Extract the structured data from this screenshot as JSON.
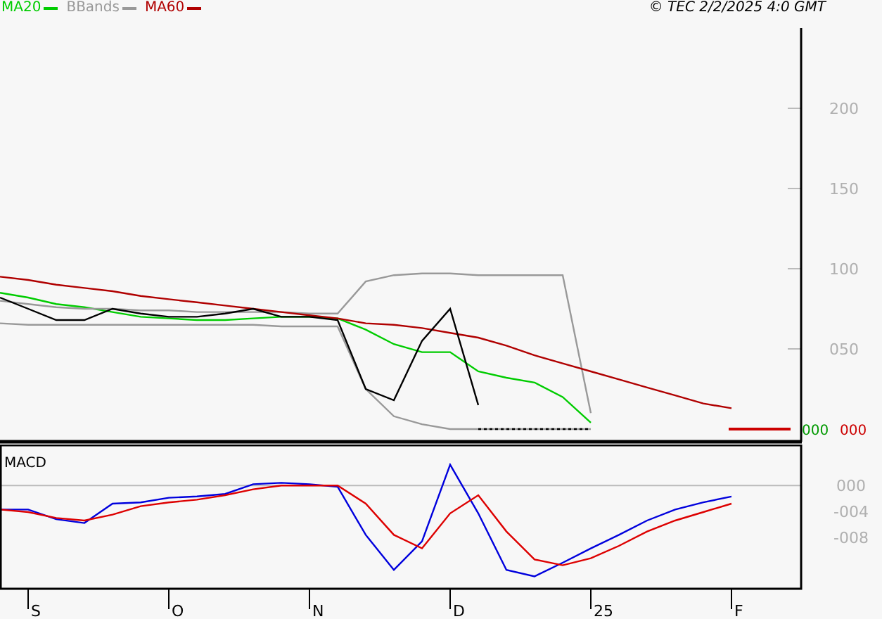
{
  "copyright": "© TEC 2/2/2025 4:0 GMT",
  "price_chart": {
    "chart_data": {
      "type": "line",
      "categories": [
        null,
        null,
        null,
        null,
        null,
        null,
        null,
        null,
        null,
        null,
        null,
        null,
        null,
        null,
        null,
        null,
        null,
        null,
        null,
        null,
        null,
        null,
        null,
        null,
        null,
        null,
        null,
        null,
        null
      ],
      "ylim": [
        -7.9,
        250
      ],
      "yticks": [
        {
          "value": 50,
          "label": "050"
        },
        {
          "value": 100,
          "label": "100"
        },
        {
          "value": 150,
          "label": "150"
        },
        {
          "value": 200,
          "label": "200"
        }
      ],
      "series": [
        {
          "name": "MA20",
          "color": "#00cc00",
          "values": [
            85,
            82,
            78,
            76,
            73,
            70,
            69,
            68,
            68,
            69,
            70,
            70,
            69,
            62,
            53,
            48,
            48,
            36,
            32,
            29,
            20,
            4,
            null,
            null,
            null,
            null,
            null,
            null,
            null
          ]
        },
        {
          "name": "BBands",
          "color": "#999999",
          "values": [
            80,
            78,
            76,
            75,
            75,
            74,
            74,
            73,
            73,
            73,
            73,
            72,
            72,
            92,
            96,
            97,
            97,
            96,
            96,
            96,
            96,
            10,
            null,
            null,
            null,
            null,
            null,
            null,
            null
          ]
        },
        {
          "name": "MA60",
          "color": "#b00000",
          "values": [
            95,
            93,
            90,
            88,
            86,
            83,
            81,
            79,
            77,
            75,
            73,
            71,
            69,
            66,
            65,
            63,
            60,
            57,
            52,
            46,
            41,
            36,
            31,
            26,
            21,
            16,
            13,
            null,
            null
          ]
        },
        {
          "color": "#999999",
          "values": [
            66,
            65,
            65,
            65,
            65,
            65,
            65,
            65,
            65,
            65,
            64,
            64,
            64,
            25,
            8,
            3,
            0,
            0,
            0,
            0,
            0,
            0,
            null,
            null,
            null,
            null,
            null,
            null,
            null
          ]
        },
        {
          "color": "#000000",
          "values": [
            82,
            75,
            68,
            68,
            75,
            72,
            70,
            70,
            72,
            75,
            70,
            70,
            68,
            25,
            18,
            55,
            75,
            15,
            null,
            null,
            null,
            null,
            null,
            null,
            null,
            null,
            null,
            null,
            null
          ]
        },
        {
          "color": "#000000",
          "line_style": "dashed",
          "values": [
            null,
            null,
            null,
            null,
            null,
            null,
            null,
            null,
            null,
            null,
            null,
            null,
            null,
            null,
            null,
            null,
            null,
            0,
            0,
            0,
            0,
            0,
            null,
            null,
            null,
            null,
            null,
            null,
            null
          ]
        }
      ]
    },
    "last_values": [
      {
        "text": "000",
        "color": "#009900"
      },
      {
        "text": "000",
        "color": "#cc0000"
      }
    ]
  },
  "macd_chart": {
    "title": "MACD",
    "chart_data": {
      "type": "line",
      "categories": [
        null,
        "S",
        null,
        null,
        null,
        null,
        "O",
        null,
        null,
        null,
        null,
        "N",
        null,
        null,
        null,
        null,
        "D",
        null,
        null,
        null,
        null,
        "25",
        null,
        null,
        null,
        null,
        "F"
      ],
      "ylim": [
        -15.8,
        6.3
      ],
      "yticks": [
        {
          "value": 0,
          "label": "000"
        },
        {
          "value": -4,
          "label": "-004"
        },
        {
          "value": -8,
          "label": "-008"
        }
      ],
      "series": [
        {
          "color": "#0000dd",
          "values": [
            -3.7,
            -3.7,
            -5.2,
            -5.8,
            -2.8,
            -2.6,
            -1.9,
            -1.7,
            -1.3,
            0.2,
            0.4,
            0.2,
            -0.2,
            -7.6,
            -13,
            -8.6,
            3.2,
            -4.3,
            -13,
            -14,
            -11.9,
            -9.7,
            -7.6,
            -5.4,
            -3.7,
            -2.6,
            -1.7
          ]
        },
        {
          "color": "#dd0000",
          "values": [
            -3.7,
            -4.1,
            -5,
            -5.4,
            -4.5,
            -3.2,
            -2.6,
            -2.2,
            -1.5,
            -0.6,
            0,
            0,
            0,
            -2.8,
            -7.6,
            -9.7,
            -4.3,
            -1.5,
            -7.1,
            -11.4,
            -12.3,
            -11.2,
            -9.3,
            -7.1,
            -5.4,
            -4.1,
            -2.8
          ]
        }
      ]
    }
  }
}
